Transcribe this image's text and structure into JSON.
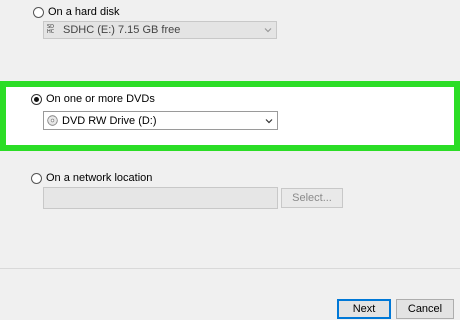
{
  "options": {
    "hard_disk": {
      "label": "On a hard disk",
      "selected": false
    },
    "dvd": {
      "label": "On one or more DVDs",
      "selected": true
    },
    "network": {
      "label": "On a network location",
      "selected": false
    }
  },
  "hard_disk_drive": {
    "icon_text_top": "SD",
    "icon_text_bottom": "HC",
    "value": "SDHC (E:)  7.15 GB free"
  },
  "dvd_drive": {
    "value": "DVD RW Drive (D:)"
  },
  "network_location": {
    "value": "",
    "select_button": "Select..."
  },
  "buttons": {
    "next": "Next",
    "cancel": "Cancel"
  },
  "colors": {
    "highlight": "#2bdd26",
    "accent": "#0078d7"
  }
}
